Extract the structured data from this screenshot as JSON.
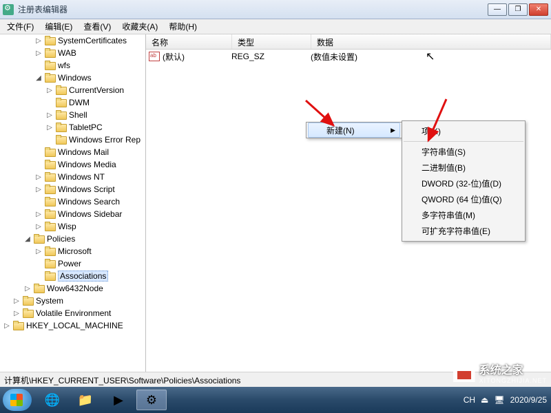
{
  "window": {
    "title": "注册表编辑器"
  },
  "menu": {
    "file": "文件(F)",
    "edit": "编辑(E)",
    "view": "查看(V)",
    "fav": "收藏夹(A)",
    "help": "帮助(H)"
  },
  "tree": {
    "n0": "SystemCertificates",
    "n1": "WAB",
    "n2": "wfs",
    "n3": "Windows",
    "n4": "CurrentVersion",
    "n5": "DWM",
    "n6": "Shell",
    "n7": "TabletPC",
    "n8": "Windows Error Rep",
    "n9": "Windows Mail",
    "n10": "Windows Media",
    "n11": "Windows NT",
    "n12": "Windows Script",
    "n13": "Windows Search",
    "n14": "Windows Sidebar",
    "n15": "Wisp",
    "n16": "Policies",
    "n17": "Microsoft",
    "n18": "Power",
    "n19": "Associations",
    "n20": "Wow6432Node",
    "n21": "System",
    "n22": "Volatile Environment",
    "n23": "HKEY_LOCAL_MACHINE"
  },
  "listhead": {
    "name": "名称",
    "type": "类型",
    "data": "数据"
  },
  "listrow": {
    "name": "(默认)",
    "type": "REG_SZ",
    "data": "(数值未设置)"
  },
  "ctx": {
    "new": "新建(N)"
  },
  "sub": {
    "key": "项(K)",
    "string": "字符串值(S)",
    "binary": "二进制值(B)",
    "dword": "DWORD (32-位)值(D)",
    "qword": "QWORD (64 位)值(Q)",
    "multi": "多字符串值(M)",
    "expand": "可扩充字符串值(E)"
  },
  "status": {
    "path": "计算机\\HKEY_CURRENT_USER\\Software\\Policies\\Associations"
  },
  "tray": {
    "ime": "CH",
    "date": "2020/9/25"
  },
  "watermark": {
    "text": "系统之家",
    "sub": "XITONGZHIJIA.NET"
  }
}
